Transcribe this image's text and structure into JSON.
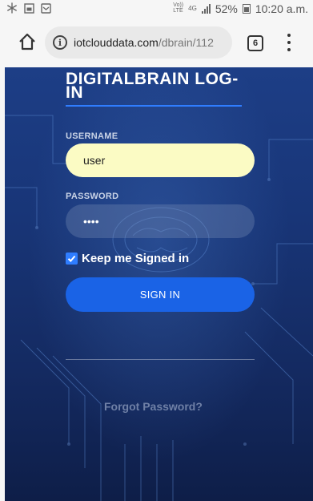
{
  "status_bar": {
    "left_icons": [
      "snowflake-icon",
      "gallery-icon",
      "notification-icon"
    ],
    "network_top": "Vo))",
    "network_bottom": "LTE",
    "network_type": "4G",
    "battery_percent": "52%",
    "time": "10:20 a.m."
  },
  "browser": {
    "url_host": "iotclouddata.com",
    "url_path": "/dbrain/112",
    "tab_count": "6"
  },
  "login": {
    "title": "DIGITALBRAIN LOG-IN",
    "username_label": "USERNAME",
    "username_value": "user",
    "password_label": "PASSWORD",
    "password_value": "••••",
    "remember_label": "Keep me Signed in",
    "remember_checked": true,
    "signin_label": "SIGN IN",
    "forgot_label": "Forgot Password?"
  },
  "colors": {
    "accent": "#2f7dff",
    "button": "#1a63e6",
    "username_bg": "#fbfbc4",
    "page_bg": "#183577"
  }
}
